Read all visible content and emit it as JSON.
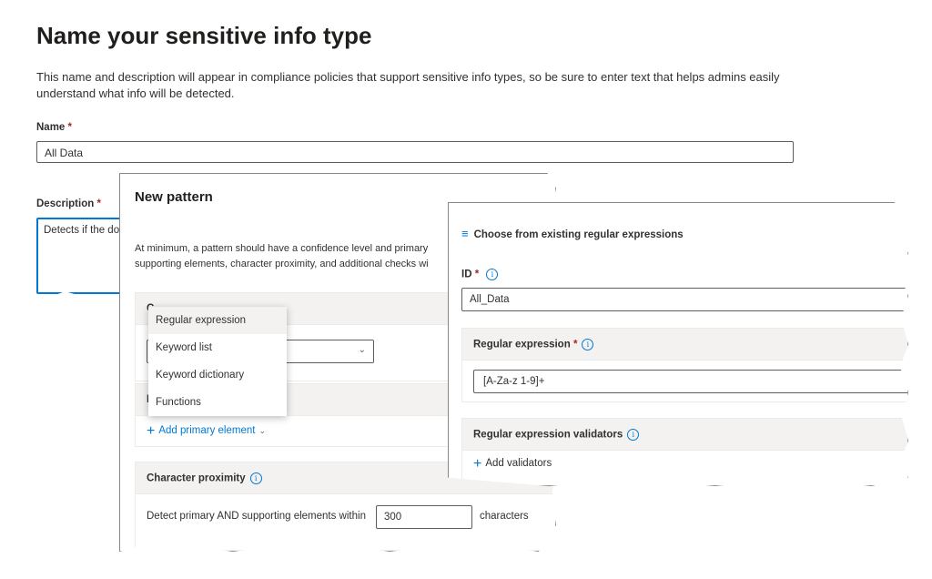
{
  "info_type": {
    "title": "Name your sensitive info type",
    "description": "This name and description will appear in compliance policies that support sensitive info types, so be sure to enter text that helps admins easily understand what info will be detected.",
    "name_label": "Name",
    "required_mark": "*",
    "name_value": "All Data",
    "description_label": "Description",
    "description_value": "Detects if the do"
  },
  "new_pattern": {
    "title": "New pattern",
    "description_line1": "At minimum, a pattern should have a confidence level and primary",
    "description_line2": "supporting elements, character proximity, and additional checks wi",
    "confidence_label_partial": "C",
    "primary_label_partial": "P",
    "add_primary_element": "Add primary element",
    "character_proximity_label": "Character proximity",
    "proximity_prefix": "Detect primary AND supporting elements within",
    "proximity_value": "300",
    "proximity_suffix": "characters",
    "dropdown_options": [
      "Regular expression",
      "Keyword list",
      "Keyword dictionary",
      "Functions"
    ]
  },
  "regex_panel": {
    "choose_existing": "Choose from existing regular expressions",
    "id_label": "ID",
    "id_value": "All_Data",
    "regex_label": "Regular expression",
    "regex_value": "[A-Za-z 1-9]+",
    "validators_label": "Regular expression validators",
    "add_validators": "Add validators"
  },
  "colors": {
    "accent": "#0078d4",
    "required": "#a4262c",
    "section_bg": "#f3f2f1"
  }
}
